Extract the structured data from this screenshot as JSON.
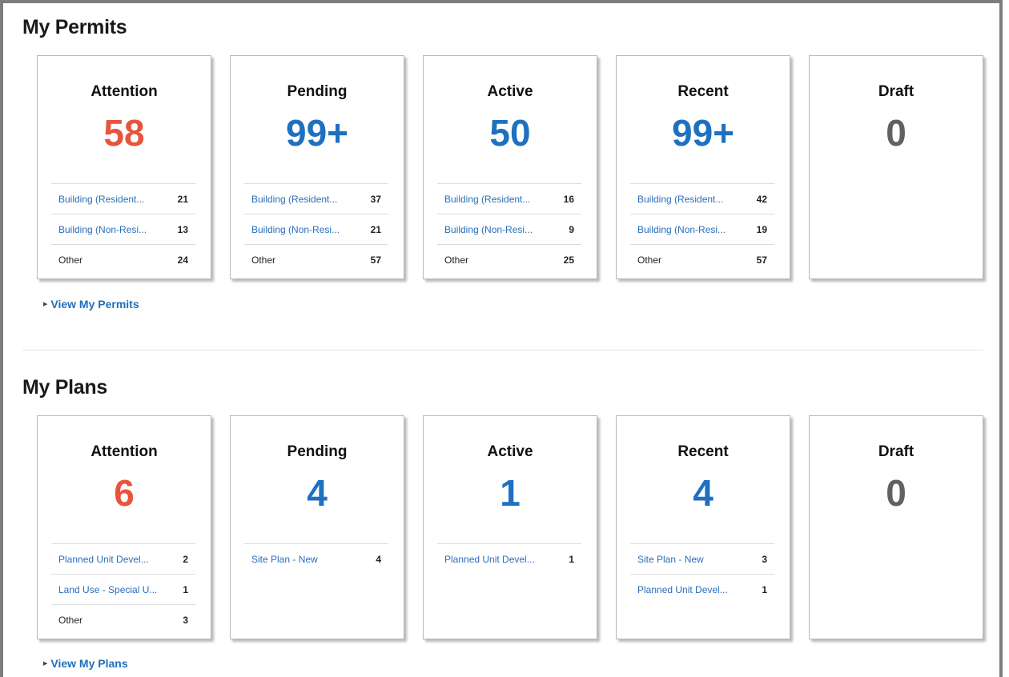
{
  "permits": {
    "title": "My Permits",
    "view_link": "View My Permits",
    "cards": [
      {
        "title": "Attention",
        "count": "58",
        "rows": [
          {
            "label": "Building (Resident...",
            "value": "21"
          },
          {
            "label": "Building (Non-Resi...",
            "value": "13"
          },
          {
            "label": "Other",
            "value": "24"
          }
        ]
      },
      {
        "title": "Pending",
        "count": "99+",
        "rows": [
          {
            "label": "Building (Resident...",
            "value": "37"
          },
          {
            "label": "Building (Non-Resi...",
            "value": "21"
          },
          {
            "label": "Other",
            "value": "57"
          }
        ]
      },
      {
        "title": "Active",
        "count": "50",
        "rows": [
          {
            "label": "Building (Resident...",
            "value": "16"
          },
          {
            "label": "Building (Non-Resi...",
            "value": "9"
          },
          {
            "label": "Other",
            "value": "25"
          }
        ]
      },
      {
        "title": "Recent",
        "count": "99+",
        "rows": [
          {
            "label": "Building (Resident...",
            "value": "42"
          },
          {
            "label": "Building (Non-Resi...",
            "value": "19"
          },
          {
            "label": "Other",
            "value": "57"
          }
        ]
      },
      {
        "title": "Draft",
        "count": "0",
        "rows": []
      }
    ]
  },
  "plans": {
    "title": "My Plans",
    "view_link": "View My Plans",
    "cards": [
      {
        "title": "Attention",
        "count": "6",
        "rows": [
          {
            "label": "Planned Unit Devel...",
            "value": "2"
          },
          {
            "label": "Land Use - Special U...",
            "value": "1"
          },
          {
            "label": "Other",
            "value": "3"
          }
        ]
      },
      {
        "title": "Pending",
        "count": "4",
        "rows": [
          {
            "label": "Site Plan - New",
            "value": "4"
          }
        ]
      },
      {
        "title": "Active",
        "count": "1",
        "rows": [
          {
            "label": "Planned Unit Devel...",
            "value": "1"
          }
        ]
      },
      {
        "title": "Recent",
        "count": "4",
        "rows": [
          {
            "label": "Site Plan - New",
            "value": "3"
          },
          {
            "label": "Planned Unit Devel...",
            "value": "1"
          }
        ]
      },
      {
        "title": "Draft",
        "count": "0",
        "rows": []
      }
    ]
  },
  "colors": {
    "attention": "#e8543c",
    "primary": "#1f70c1",
    "draft": "#616161",
    "link": "#2a6ebb"
  },
  "icons": {
    "view_link": "triangle-right-icon"
  }
}
